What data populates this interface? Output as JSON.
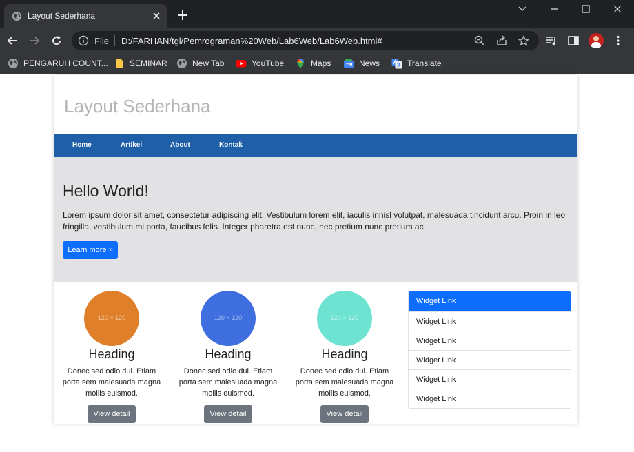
{
  "browser": {
    "tab_title": "Layout Sederhana",
    "scheme_label": "File",
    "url": "D:/FARHAN/tgl/Pemrograman%20Web/Lab6Web/Lab6Web.html#",
    "bookmarks": [
      {
        "label": "PENGARUH COUNT...",
        "icon": "globe-icon"
      },
      {
        "label": "SEMINAR",
        "icon": "folder-icon"
      },
      {
        "label": "New Tab",
        "icon": "globe-icon"
      },
      {
        "label": "YouTube",
        "icon": "youtube-icon"
      },
      {
        "label": "Maps",
        "icon": "maps-icon"
      },
      {
        "label": "News",
        "icon": "news-icon"
      },
      {
        "label": "Translate",
        "icon": "translate-icon"
      }
    ]
  },
  "page": {
    "site_title": "Layout Sederhana",
    "nav": [
      "Home",
      "Artikel",
      "About",
      "Kontak"
    ],
    "hero": {
      "title": "Hello World!",
      "text": "Lorem ipsum dolor sit amet, consectetur adipiscing elit. Vestibulum lorem elit, iaculis innisl volutpat, malesuada tincidunt arcu. Proin in leo fringilla, vestibulum mi porta, faucibus felis. Integer pharetra est nunc, nec pretium nunc pretium ac.",
      "button": "Learn more »"
    },
    "cards": [
      {
        "placeholder": "120 × 120",
        "color": "#e07f2a",
        "heading": "Heading",
        "text": "Donec sed odio dui. Etiam porta sem malesuada magna mollis euismod.",
        "button": "View detail"
      },
      {
        "placeholder": "120 × 120",
        "color": "#3f6fdf",
        "heading": "Heading",
        "text": "Donec sed odio dui. Etiam porta sem malesuada magna mollis euismod.",
        "button": "View detail"
      },
      {
        "placeholder": "120 × 120",
        "color": "#6fe3d2",
        "heading": "Heading",
        "text": "Donec sed odio dui. Etiam porta sem malesuada magna mollis euismod.",
        "button": "View detail"
      }
    ],
    "widget_links": [
      "Widget Link",
      "Widget Link",
      "Widget Link",
      "Widget Link",
      "Widget Link",
      "Widget Link"
    ]
  },
  "colors": {
    "nav_bar": "#1f5fa8",
    "hero_bg": "#e2e2e5",
    "primary": "#0d6efd",
    "secondary_button": "#6c757d"
  }
}
